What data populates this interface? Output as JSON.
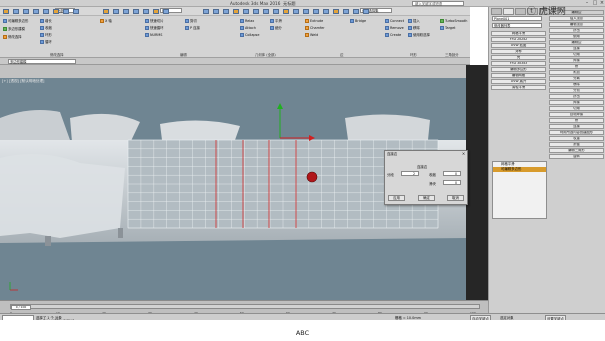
{
  "app": {
    "title": "Autodesk 3ds Max 2016",
    "file": "无标题",
    "search_placeholder": "键入关键字或短语"
  },
  "menu": [
    "编辑",
    "工具",
    "组",
    "视图",
    "创建",
    "修改器",
    "动画",
    "图形编辑器",
    "渲染",
    "Civil View",
    "自定义",
    "脚本",
    "帮助",
    "Arnold"
  ],
  "toolbar": {
    "selection_filter": "全部",
    "view_dropdown": "视图",
    "selection_set": "创建选择集"
  },
  "ribbon": {
    "groups": [
      {
        "label": "修改选择",
        "buttons": [
          "增长",
          "收缩",
          "环形",
          "循环",
          "X 轴"
        ]
      },
      {
        "label": "编辑",
        "buttons": [
          "快速切片",
          "快速循环",
          "NURMS",
          "剪切",
          "P 连接"
        ]
      },
      {
        "label": "几何体 (全部)",
        "buttons": [
          "Relax",
          "Attach",
          "Collapse",
          "平滑",
          "细分"
        ]
      },
      {
        "label": "边",
        "buttons": [
          "Extrude",
          "Chamfer",
          "Weld",
          "Bridge",
          "Connect",
          "Remove",
          "Create"
        ]
      },
      {
        "label": "环形",
        "buttons": [
          "插入",
          "移除",
          "使用软选择"
        ]
      },
      {
        "label": "三角剖分",
        "buttons": [
          "TurboSmooth",
          "Target"
        ]
      }
    ],
    "left_tools": [
      "可编辑多边形",
      "多边形建模",
      "修改选择"
    ],
    "sub_dropdown": "多边形建模"
  },
  "viewport": {
    "label": "[+] [透视] [默认明暗处理]"
  },
  "dialog": {
    "title": "连接边",
    "section": "连接边",
    "segments_label": "分段",
    "segments_value": "2",
    "pinch_label": "收缩",
    "pinch_value": "0",
    "slide_label": "滑块",
    "slide_value": "0",
    "ok": "应用",
    "apply": "确定",
    "cancel": "取消"
  },
  "command_panel": {
    "object_name": "Plane001",
    "modifier_list": "修改器列表",
    "left_list": [
      "网格平滑",
      "FFD 2x2x2",
      "UVW 贴图",
      "对称",
      "壳",
      "FFD 3x3x3",
      "编辑多边形",
      "编辑网格",
      "UVW 展开",
      "涡轮平滑"
    ],
    "right_list": [
      "编辑顶点",
      "挤出",
      "倒角",
      "编辑边",
      "连接",
      "切角",
      "焊接",
      "桥",
      "附加",
      "分离"
    ],
    "stack": [
      {
        "label": "网格平滑",
        "selected": false
      },
      {
        "label": "可编辑多边形",
        "selected": true
      }
    ],
    "rollout_title": "编辑边",
    "rollout_sub": "插入顶点",
    "buttons": [
      "移除",
      "分割",
      "挤出",
      "焊接",
      "切角",
      "目标焊接",
      "桥",
      "连接",
      "利用所选内容创建图形",
      "权重",
      "折缝",
      "编辑三角形",
      "旋转"
    ]
  },
  "timeline": {
    "frame": "0 / 100",
    "ticks": [
      "0",
      "10",
      "20",
      "30",
      "40",
      "50",
      "60",
      "70",
      "80",
      "90",
      "100"
    ]
  },
  "status": {
    "selected": "选择了 1 个 对象",
    "hint": "单击或单击并拖动以选择对象",
    "grid": "栅格 = 10.0mm",
    "autokey": "自动关键点",
    "set_key": "设置关键点",
    "filter": "选定对象"
  },
  "caption": "ABC",
  "watermark": "虎课网"
}
